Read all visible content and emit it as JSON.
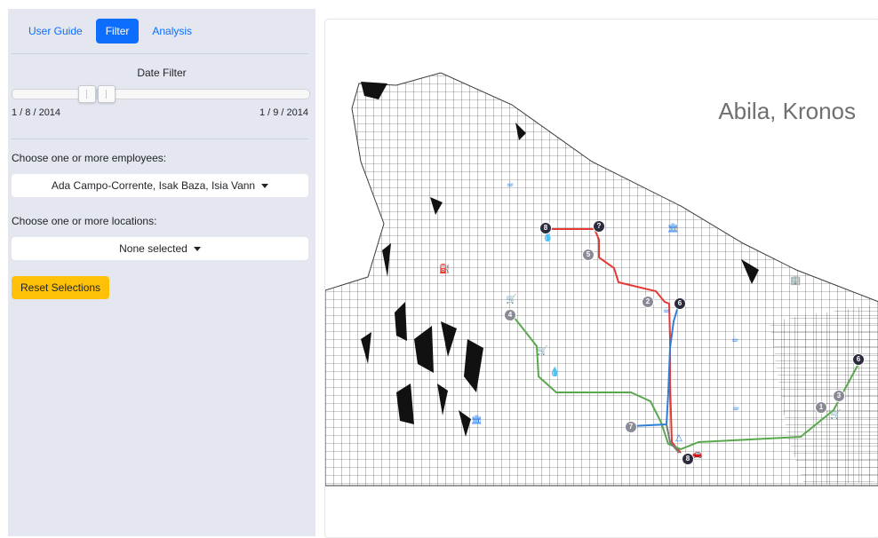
{
  "tabs": {
    "user_guide": "User Guide",
    "filter": "Filter",
    "analysis": "Analysis"
  },
  "date_filter": {
    "title": "Date Filter",
    "min_label": "1 / 8 / 2014",
    "max_label": "1 / 9 / 2014"
  },
  "employees": {
    "label": "Choose one or more employees:",
    "selected": "Ada Campo-Corrente, Isak Baza, Isia Vann"
  },
  "locations": {
    "label": "Choose one or more locations:",
    "selected": "None selected"
  },
  "reset_label": "Reset Selections",
  "map": {
    "title": "Abila, Kronos"
  },
  "route_colors": {
    "red": "#e53935",
    "green": "#5aa84e",
    "blue": "#2f7fd8",
    "grey": "#7a7a7a"
  },
  "markers": [
    "8",
    "?",
    "5",
    "2",
    "6",
    "4",
    "6",
    "7",
    "8",
    "1",
    "3"
  ]
}
